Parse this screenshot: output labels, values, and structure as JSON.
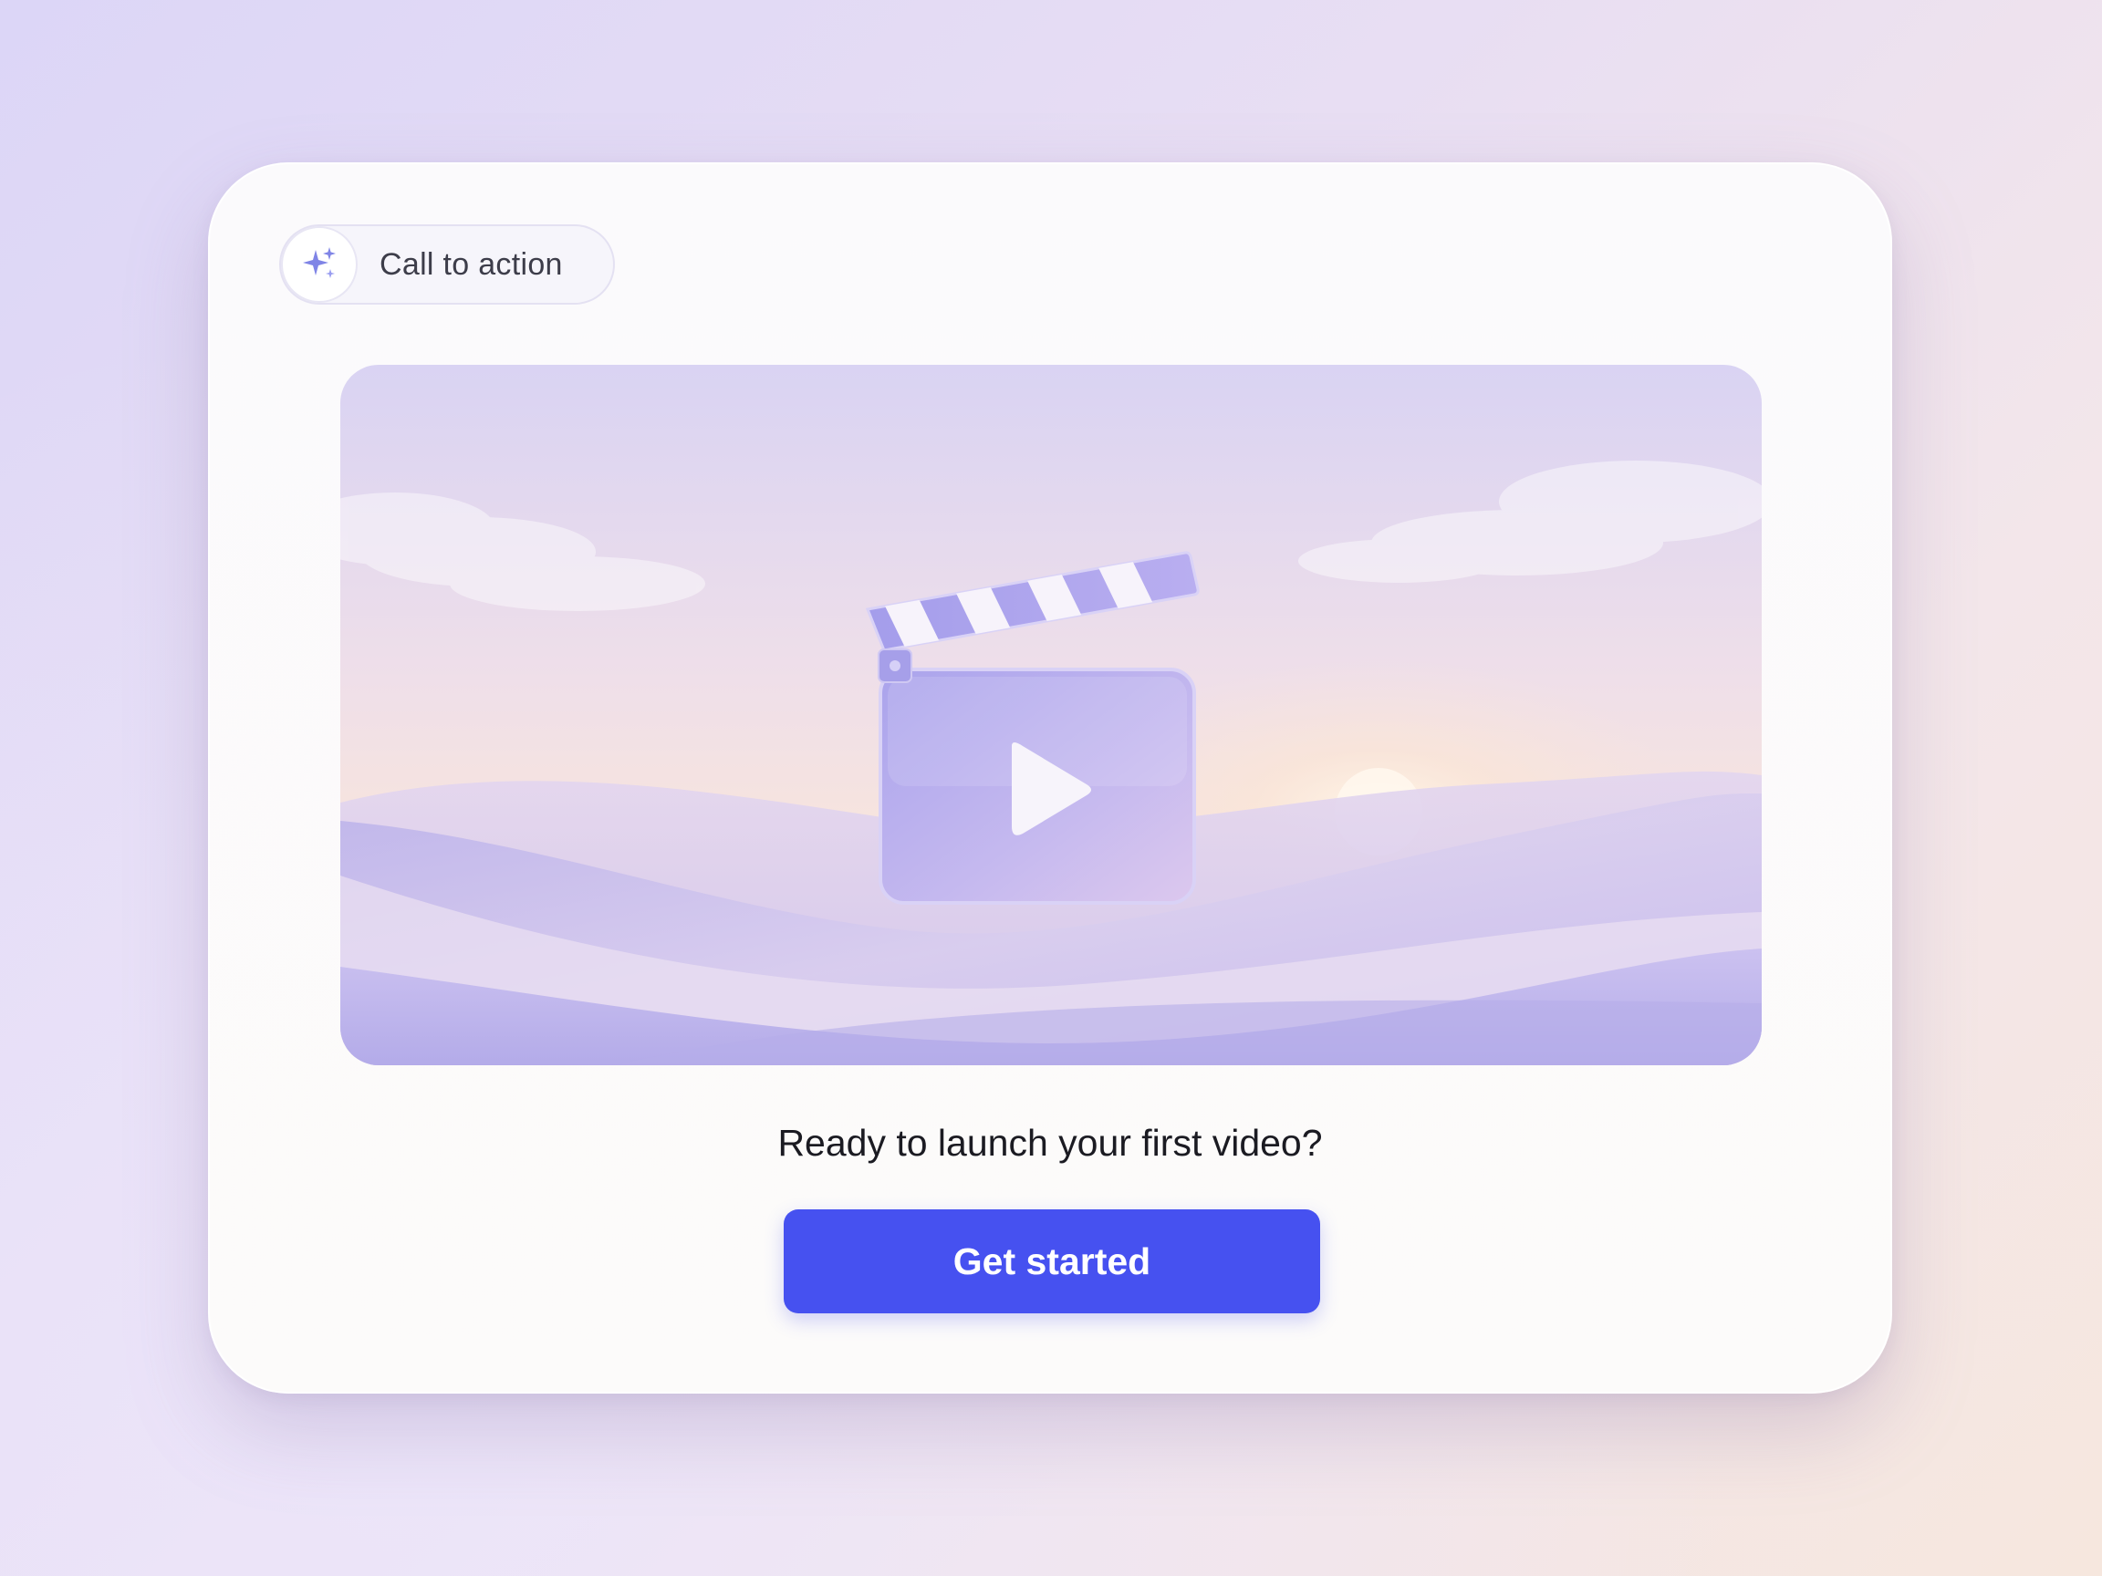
{
  "badge": {
    "icon": "sparkles-icon",
    "label": "Call to action",
    "icon_color": "#7f84e6"
  },
  "media": {
    "icon": "clapperboard-play-icon"
  },
  "headline": "Ready to launch your first video?",
  "cta": {
    "label": "Get started",
    "color": "#4651f0"
  }
}
